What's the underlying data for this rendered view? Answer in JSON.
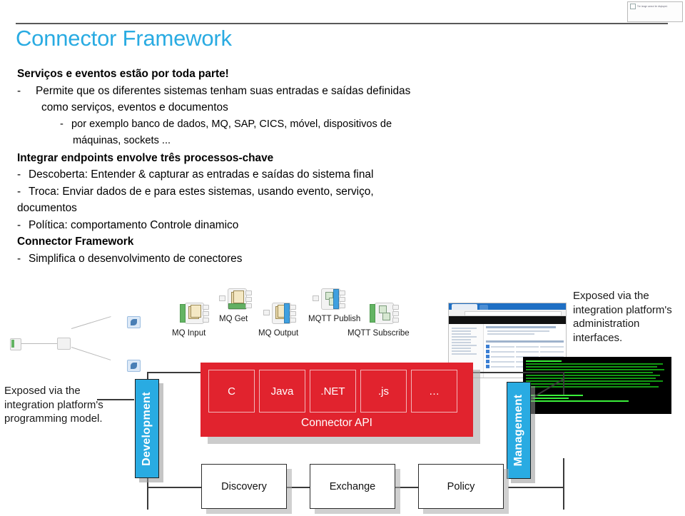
{
  "slide": {
    "title": "Connector Framework",
    "heading": "Serviços e eventos estão por toda parte!",
    "lines": [
      {
        "text": "Permite que os diferentes sistemas tenham suas entradas e saídas definidas"
      },
      {
        "text": "como serviços, eventos e documentos"
      },
      {
        "text": "por exemplo banco de dados, MQ, SAP, CICS, móvel, dispositivos de"
      },
      {
        "text": "máquinas, sockets ..."
      },
      {
        "text": "Integrar endpoints envolve três processos-chave"
      },
      {
        "text": "Descoberta: Entender & capturar as entradas e saídas do sistema final"
      },
      {
        "text": "Troca: Enviar dados de e para estes sistemas, usando evento, serviço,"
      },
      {
        "text": "documentos"
      },
      {
        "text": "Política: comportamento Controle dinamico"
      },
      {
        "text": "Connector Framework"
      },
      {
        "text": "Simplifica o desenvolvimento de conectores"
      }
    ],
    "dash": "-"
  },
  "diagram": {
    "palette_nodes": [
      {
        "label": "MQ Input"
      },
      {
        "label": "MQ Get"
      },
      {
        "label": "MQ Output"
      },
      {
        "label": "MQTT Publish"
      },
      {
        "label": "MQTT Subscribe"
      }
    ],
    "api": {
      "title": "Connector API",
      "languages": [
        "C",
        "Java",
        ".NET",
        ".js",
        "…"
      ]
    },
    "vertical_bars": [
      {
        "label": "Development"
      },
      {
        "label": "Management"
      }
    ],
    "process_boxes": [
      "Discovery",
      "Exchange",
      "Policy"
    ],
    "captions": {
      "left": "Exposed via the integration platform's programming model.",
      "right": "Exposed via the integration platform's administration interfaces."
    }
  },
  "broken_image": {
    "alt_text": "The image cannot be displayed."
  },
  "colors": {
    "title_blue": "#29abe2",
    "api_red": "#e1232e",
    "bar_teal": "#29abe2",
    "rule_gray": "#595959"
  }
}
